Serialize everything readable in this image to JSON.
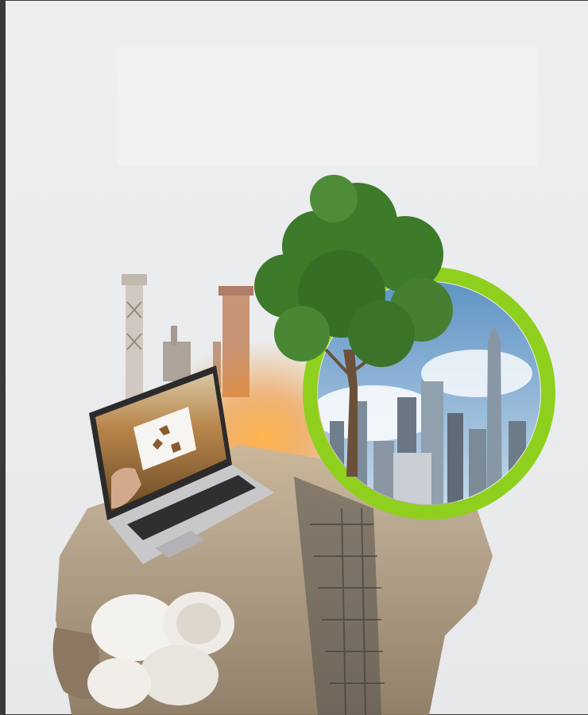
{
  "image": {
    "subject": "sustainability-collage",
    "colors": {
      "background": "#eceef0",
      "ring": "#8fd01f",
      "tree": "#3d7a2a",
      "sky": "#7ba8cf",
      "jacket": "#b9a58a",
      "glow": "#f28a1e"
    }
  }
}
